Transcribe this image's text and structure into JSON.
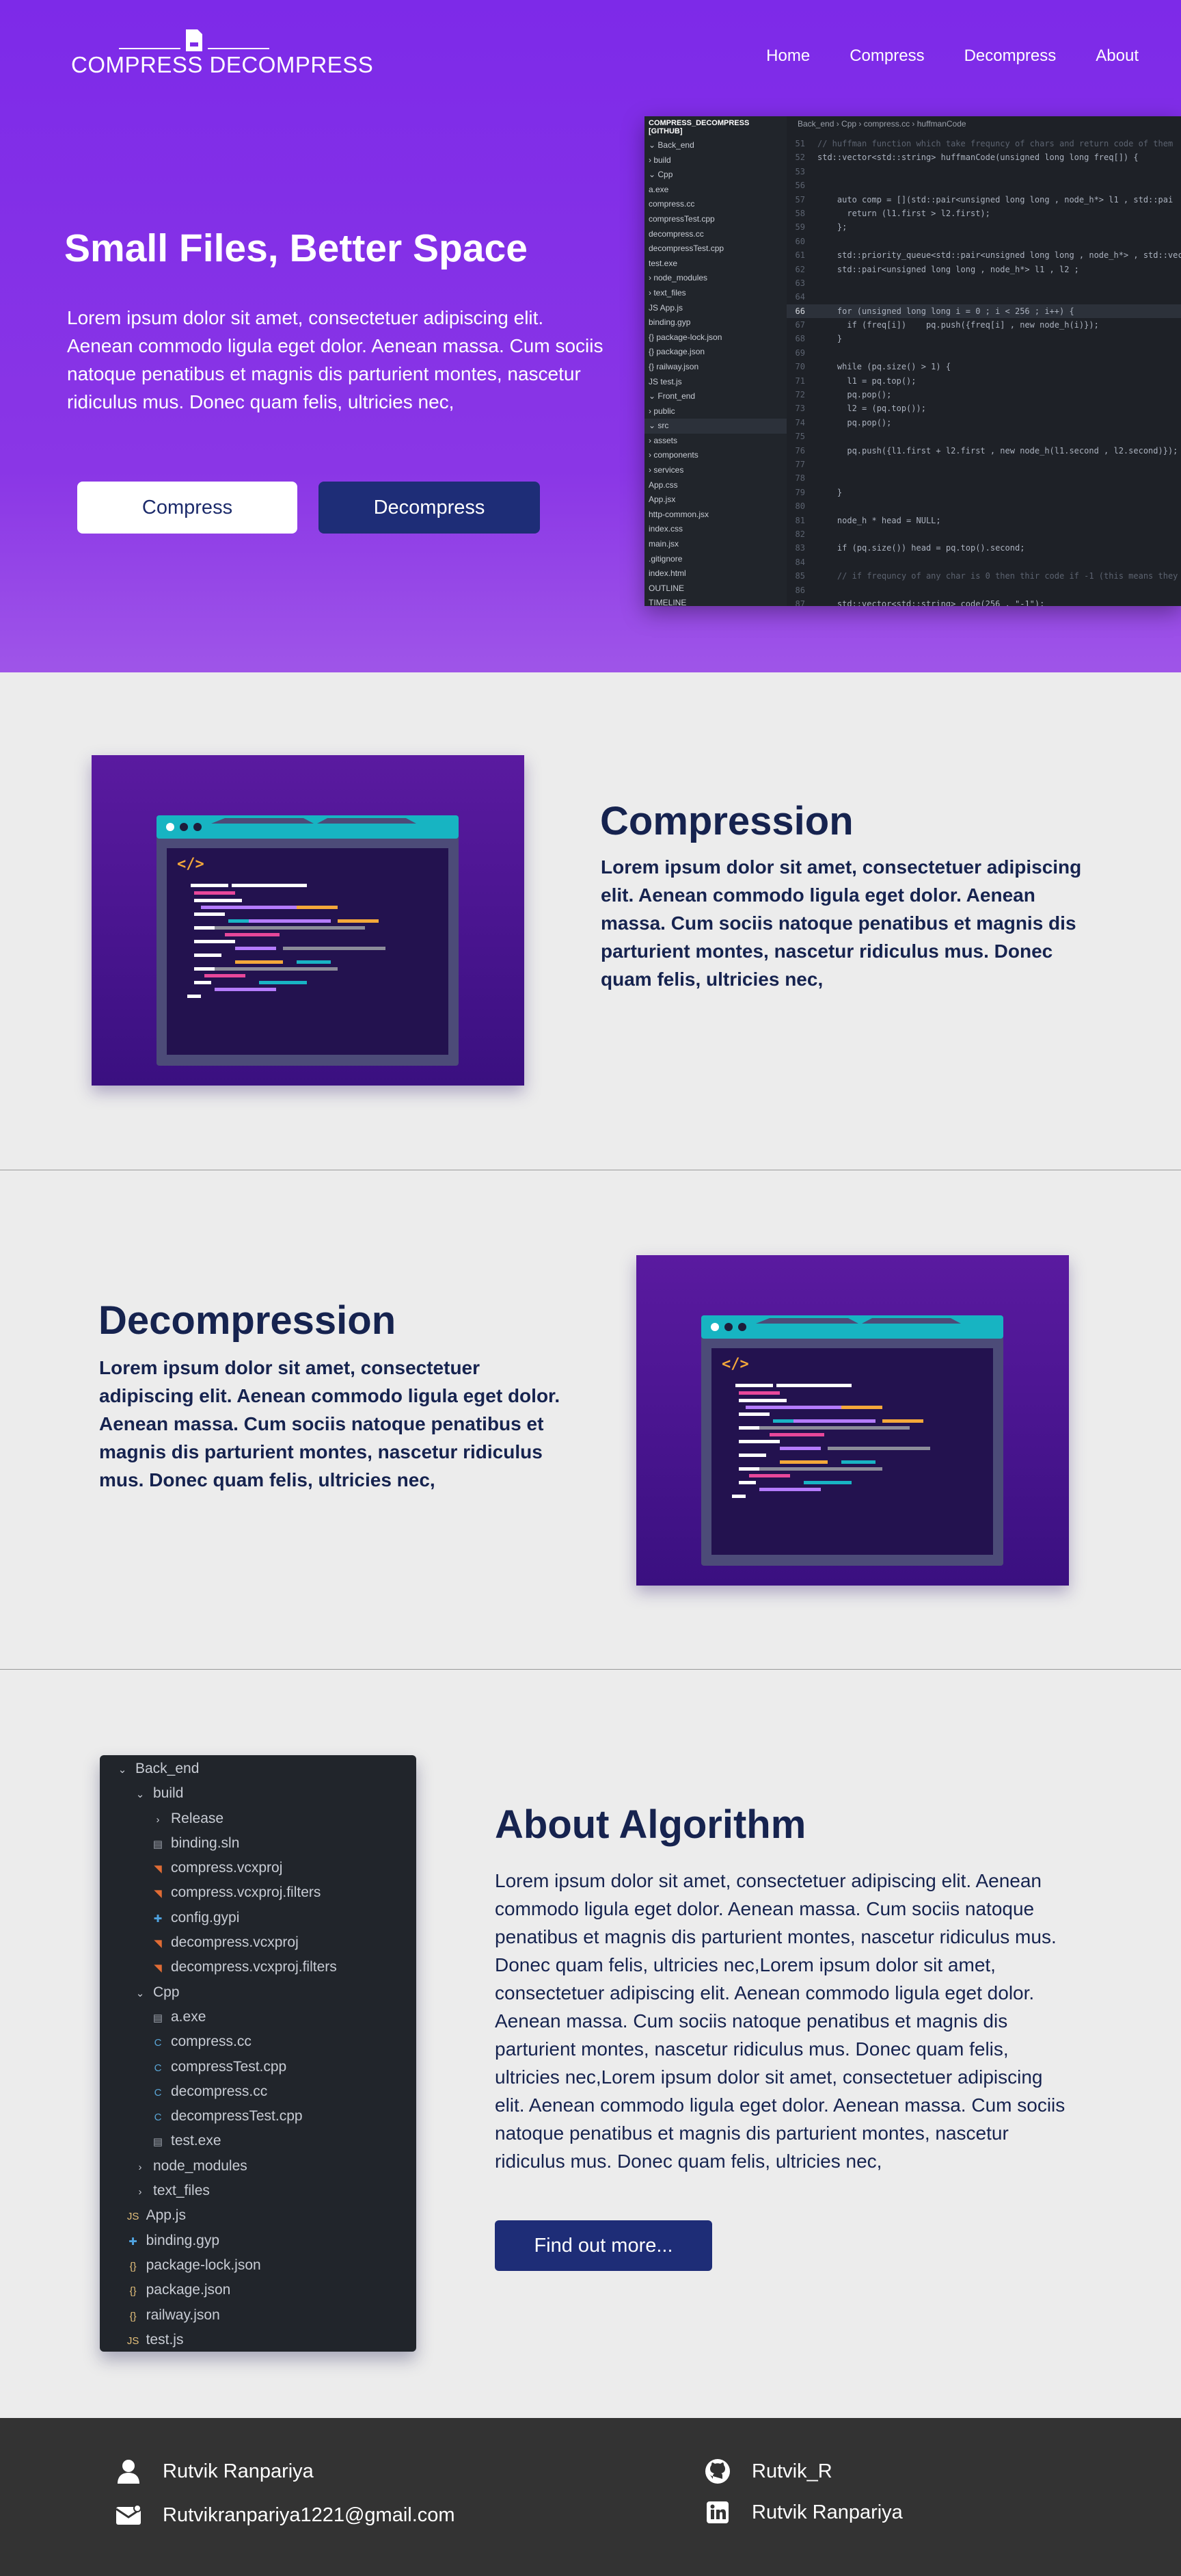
{
  "colors": {
    "hero_gradient_top": "#7d2ae8",
    "hero_gradient_bottom": "#9f55e8",
    "navy": "#1e2d77",
    "heading": "#16234f",
    "section_bg": "#ececec",
    "footer_bg": "#333333",
    "editor_bg": "#1e2127"
  },
  "nav": {
    "logo_text": "COMPRESS DECOMPRESS",
    "logo_icon": "zip-file-icon",
    "links": [
      "Home",
      "Compress",
      "Decompress",
      "About"
    ]
  },
  "hero": {
    "title": "Small Files, Better Space",
    "text": "Lorem ipsum dolor sit amet, consectetuer adipiscing elit. Aenean commodo ligula eget dolor. Aenean massa. Cum sociis natoque penatibus et magnis dis parturient montes, nascetur ridiculus mus. Donec quam felis, ultricies nec,",
    "compress_button": "Compress",
    "decompress_button": "Decompress"
  },
  "editor": {
    "explorer_title": "COMPRESS_DECOMPRESS [GITHUB]",
    "breadcrumb": "Back_end  ›  Cpp  ›  compress.cc  ›  huffmanCode",
    "tree": [
      "⌄ Back_end",
      "  › build",
      "  ⌄ Cpp",
      "     a.exe",
      "     compress.cc",
      "     compressTest.cpp",
      "     decompress.cc",
      "     decompressTest.cpp",
      "     test.exe",
      "  › node_modules",
      "  › text_files",
      "  JS App.js",
      "  binding.gyp",
      "  {} package-lock.json",
      "  {} package.json",
      "  {} railway.json",
      "  JS test.js",
      "⌄ Front_end",
      "  › public",
      "  ⌄ src",
      "    › assets",
      "    › components",
      "    › services",
      "     App.css",
      "     App.jsx",
      "     http-common.jsx",
      "     index.css",
      "     main.jsx",
      "  .gitignore",
      "  index.html",
      "OUTLINE",
      "TIMELINE"
    ],
    "lines": [
      {
        "n": "51",
        "code": "// huffman function which take frequncy of chars and return code of them"
      },
      {
        "n": "52",
        "code": "std::vector<std::string> huffmanCode(unsigned long long freq[]) {"
      },
      {
        "n": "53",
        "code": ""
      },
      {
        "n": "56",
        "code": ""
      },
      {
        "n": "57",
        "code": "    auto comp = [](std::pair<unsigned long long , node_h*> l1 , std::pai"
      },
      {
        "n": "58",
        "code": "      return (l1.first > l2.first);"
      },
      {
        "n": "59",
        "code": "    };"
      },
      {
        "n": "60",
        "code": ""
      },
      {
        "n": "61",
        "code": "    std::priority_queue<std::pair<unsigned long long , node_h*> , std::vec"
      },
      {
        "n": "62",
        "code": "    std::pair<unsigned long long , node_h*> l1 , l2 ;"
      },
      {
        "n": "63",
        "code": ""
      },
      {
        "n": "64",
        "code": ""
      },
      {
        "n": "66",
        "code": "    for (unsigned long long i = 0 ; i < 256 ; i++) {",
        "current": true
      },
      {
        "n": "67",
        "code": "      if (freq[i])    pq.push({freq[i] , new node_h(i)});"
      },
      {
        "n": "68",
        "code": "    }"
      },
      {
        "n": "69",
        "code": ""
      },
      {
        "n": "70",
        "code": "    while (pq.size() > 1) {"
      },
      {
        "n": "71",
        "code": "      l1 = pq.top();"
      },
      {
        "n": "72",
        "code": "      pq.pop();"
      },
      {
        "n": "73",
        "code": "      l2 = (pq.top());"
      },
      {
        "n": "74",
        "code": "      pq.pop();"
      },
      {
        "n": "75",
        "code": ""
      },
      {
        "n": "76",
        "code": "      pq.push({l1.first + l2.first , new node_h(l1.second , l2.second)});"
      },
      {
        "n": "77",
        "code": ""
      },
      {
        "n": "78",
        "code": ""
      },
      {
        "n": "79",
        "code": "    }"
      },
      {
        "n": "80",
        "code": ""
      },
      {
        "n": "81",
        "code": "    node_h * head = NULL;"
      },
      {
        "n": "82",
        "code": ""
      },
      {
        "n": "83",
        "code": "    if (pq.size()) head = pq.top().second;"
      },
      {
        "n": "84",
        "code": ""
      },
      {
        "n": "85",
        "code": "    // if frequncy of any char is 0 then thir code if -1 (this means they"
      },
      {
        "n": "86",
        "code": ""
      },
      {
        "n": "87",
        "code": "    std::vector<std::string> code(256 , \"-1\");"
      }
    ]
  },
  "compression": {
    "title": "Compression",
    "text": "Lorem ipsum dolor sit amet, consectetuer adipiscing elit. Aenean commodo ligula eget dolor. Aenean massa. Cum sociis natoque penatibus et magnis dis parturient montes, nascetur ridiculus mus. Donec quam felis, ultricies nec,",
    "illustration": "code-window-illustration"
  },
  "decompression": {
    "title": "Decompression",
    "text": "Lorem ipsum dolor sit amet, consectetuer adipiscing elit. Aenean commodo ligula eget dolor. Aenean massa. Cum sociis natoque penatibus et magnis dis parturient montes, nascetur ridiculus mus. Donec quam felis, ultricies nec,",
    "illustration": "code-window-illustration"
  },
  "about": {
    "title": "About Algorithm",
    "text": "Lorem ipsum dolor sit amet, consectetuer adipiscing elit. Aenean commodo ligula eget dolor. Aenean massa. Cum sociis natoque penatibus et magnis dis parturient montes, nascetur ridiculus mus. Donec quam felis, ultricies nec,Lorem ipsum dolor sit amet, consectetuer adipiscing elit. Aenean commodo ligula eget dolor. Aenean massa. Cum sociis natoque penatibus et magnis dis parturient montes, nascetur ridiculus mus. Donec quam felis, ultricies nec,Lorem ipsum dolor sit amet, consectetuer adipiscing elit. Aenean commodo ligula eget dolor. Aenean massa. Cum sociis natoque penatibus et magnis dis parturient montes, nascetur ridiculus mus. Donec quam felis, ultricies nec,",
    "button": "Find out more...",
    "tree": [
      {
        "label": "Back_end",
        "icon": "⌄",
        "indent": 0,
        "color": "#c8ccd4"
      },
      {
        "label": "build",
        "icon": "⌄",
        "indent": 1,
        "color": "#c8ccd4"
      },
      {
        "label": "Release",
        "icon": "›",
        "indent": 2,
        "color": "#c8ccd4"
      },
      {
        "label": "binding.sln",
        "icon": "▤",
        "indent": 2,
        "color": "#9aa0aa"
      },
      {
        "label": "compress.vcxproj",
        "icon": "◥",
        "indent": 2,
        "color": "#e06c35"
      },
      {
        "label": "compress.vcxproj.filters",
        "icon": "◥",
        "indent": 2,
        "color": "#e06c35"
      },
      {
        "label": "config.gypi",
        "icon": "✚",
        "indent": 2,
        "color": "#4fa3e0"
      },
      {
        "label": "decompress.vcxproj",
        "icon": "◥",
        "indent": 2,
        "color": "#e06c35"
      },
      {
        "label": "decompress.vcxproj.filters",
        "icon": "◥",
        "indent": 2,
        "color": "#e06c35"
      },
      {
        "label": "Cpp",
        "icon": "⌄",
        "indent": 1,
        "color": "#c8ccd4"
      },
      {
        "label": "a.exe",
        "icon": "▤",
        "indent": 2,
        "color": "#9aa0aa"
      },
      {
        "label": "compress.cc",
        "icon": "C",
        "indent": 2,
        "color": "#5aa6d6"
      },
      {
        "label": "compressTest.cpp",
        "icon": "C",
        "indent": 2,
        "color": "#5aa6d6"
      },
      {
        "label": "decompress.cc",
        "icon": "C",
        "indent": 2,
        "color": "#5aa6d6"
      },
      {
        "label": "decompressTest.cpp",
        "icon": "C",
        "indent": 2,
        "color": "#5aa6d6"
      },
      {
        "label": "test.exe",
        "icon": "▤",
        "indent": 2,
        "color": "#9aa0aa"
      },
      {
        "label": "node_modules",
        "icon": "›",
        "indent": 1,
        "color": "#c8ccd4"
      },
      {
        "label": "text_files",
        "icon": "›",
        "indent": 1,
        "color": "#c8ccd4"
      },
      {
        "label": "App.js",
        "icon": "JS",
        "indent": 0.6,
        "color": "#e5c07b"
      },
      {
        "label": "binding.gyp",
        "icon": "✚",
        "indent": 0.6,
        "color": "#4fa3e0"
      },
      {
        "label": "package-lock.json",
        "icon": "{}",
        "indent": 0.6,
        "color": "#e5c07b"
      },
      {
        "label": "package.json",
        "icon": "{}",
        "indent": 0.6,
        "color": "#e5c07b"
      },
      {
        "label": "railway.json",
        "icon": "{}",
        "indent": 0.6,
        "color": "#e5c07b"
      },
      {
        "label": "test.js",
        "icon": "JS",
        "indent": 0.6,
        "color": "#e5c07b"
      }
    ]
  },
  "footer": {
    "name": "Rutvik Ranpariya",
    "email": "Rutvikranpariya1221@gmail.com",
    "github": "Rutvik_R",
    "linkedin": "Rutvik Ranpariya",
    "icons": {
      "name": "user-icon",
      "email": "mail-icon",
      "github": "github-icon",
      "linkedin": "linkedin-icon"
    }
  }
}
